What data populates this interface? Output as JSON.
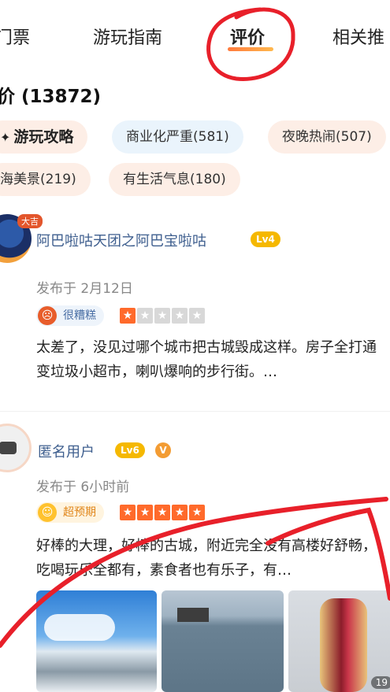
{
  "tabs": [
    {
      "label": "门票"
    },
    {
      "label": "游玩指南"
    },
    {
      "label": "评价"
    },
    {
      "label": "相关推"
    }
  ],
  "reviews_header": {
    "title": "价 (13872)"
  },
  "chips": [
    {
      "label": "游玩攻略"
    },
    {
      "label": "商业化严重(581)"
    },
    {
      "label": "夜晚热闹(507)"
    },
    {
      "label": "海美景(219)"
    },
    {
      "label": "有生活气息(180)"
    }
  ],
  "reviews": [
    {
      "avatar_badge": "大吉",
      "username": "阿巴啦咕天团之阿巴宝啦咕",
      "level": "Lv4",
      "posted": "发布于 2月12日",
      "rating_label": "很糟糕",
      "stars": 1,
      "text": "太差了，没见过哪个城市把古城毁成这样。房子全打通变垃圾小超市，喇叭爆响的步行街。…"
    },
    {
      "username": "匿名用户",
      "level": "Lv6",
      "verified": "V",
      "posted": "发布于 6小时前",
      "rating_label": "超预期",
      "stars": 5,
      "text": "好棒的大理，好棒的古城，附近完全没有高楼好舒畅，吃喝玩乐全都有，素食者也有乐子，有…",
      "photo_count": "19"
    }
  ],
  "colors": {
    "accent_orange": "#ff6a2b",
    "username_blue": "#3e5e8e",
    "level_badge": "#f5b800",
    "annotation_red": "#e8202a"
  }
}
